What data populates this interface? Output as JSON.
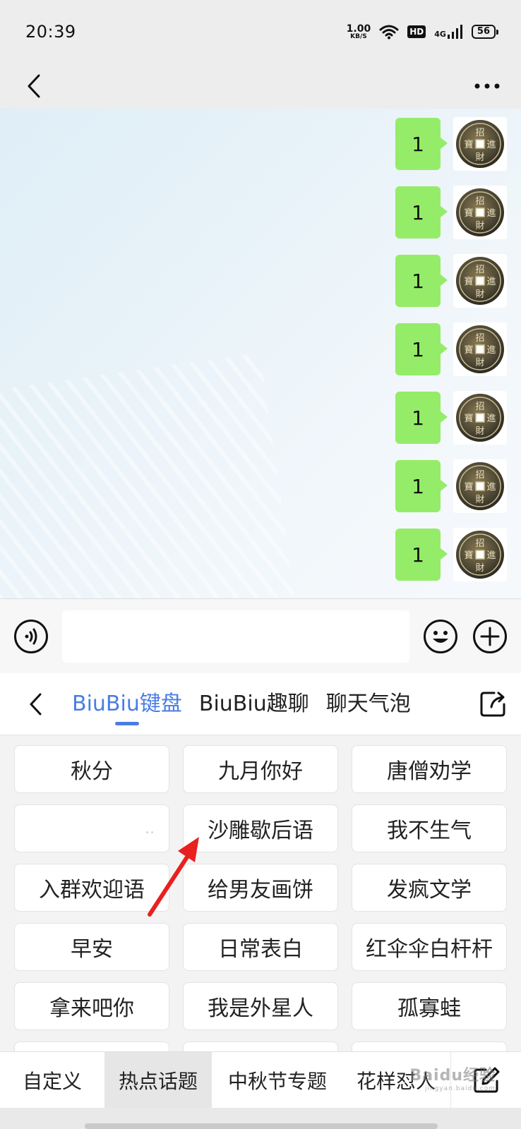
{
  "status_bar": {
    "time": "20:39",
    "net_speed_value": "1.00",
    "net_speed_unit": "KB/S",
    "hd": "HD",
    "network": "4G",
    "battery": "56"
  },
  "chat": {
    "bubble_color": "#95ec69",
    "messages": [
      {
        "text": "1"
      },
      {
        "text": "1"
      },
      {
        "text": "1"
      },
      {
        "text": "1"
      },
      {
        "text": "1"
      },
      {
        "text": "1"
      },
      {
        "text": "1"
      }
    ],
    "avatar": {
      "icon": "ancient-coin-avatar",
      "characters": [
        "招",
        "進",
        "財",
        "寶"
      ]
    }
  },
  "input_bar": {
    "voice_icon": "voice-icon",
    "emoji_icon": "emoji-icon",
    "plus_icon": "plus-icon",
    "input_value": ""
  },
  "keyboard": {
    "tabs": [
      {
        "label": "BiuBiu键盘",
        "active": true
      },
      {
        "label": "BiuBiu趣聊",
        "active": false
      },
      {
        "label": "聊天气泡",
        "active": false
      }
    ],
    "accent_color": "#4a7de3",
    "items": [
      "秋分",
      "九月你好",
      "唐僧劝学",
      "..",
      "沙雕歇后语",
      "我不生气",
      "入群欢迎语",
      "给男友画饼",
      "发疯文学",
      "早安",
      "日常表白",
      "红伞伞白杆杆",
      "拿来吧你",
      "我是外星人",
      "孤寡蛙"
    ],
    "categories": [
      {
        "label": "自定义",
        "active": false
      },
      {
        "label": "热点话题",
        "active": true
      },
      {
        "label": "中秋节专题",
        "active": false
      },
      {
        "label": "花样怼人",
        "active": false
      }
    ]
  },
  "annotation": {
    "arrow_color": "#e8201f"
  },
  "watermark": {
    "brand": "Baidu经验",
    "site": "jingyan.baidu.com"
  }
}
